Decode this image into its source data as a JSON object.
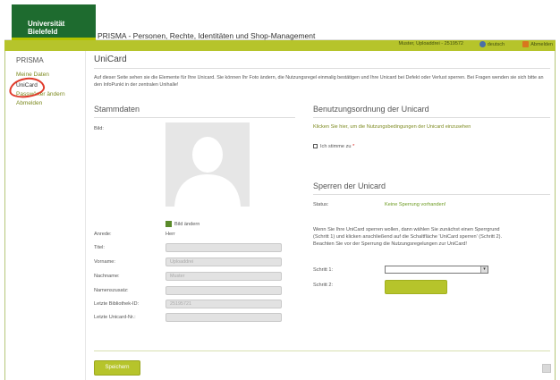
{
  "header": {
    "logo_text": "Universität Bielefeld",
    "app_title": "PRISMA - Personen, Rechte, Identitäten und Shop-Management"
  },
  "userbar": {
    "user": "Muster, Uploaddrei - 2519572",
    "language": "deutsch",
    "logout": "Abmelden"
  },
  "sidebar": {
    "heading": "PRISMA",
    "items": [
      {
        "label": "Meine Daten"
      },
      {
        "label": "UniCard"
      },
      {
        "label": "Passwörter ändern"
      },
      {
        "label": "Abmelden"
      }
    ]
  },
  "main": {
    "title": "UniCard",
    "intro": "Auf dieser Seite sehen sie die Elemente für Ihre Unicard. Sie können Ihr Foto ändern, die Nutzungsregel einmalig bestätigen und Ihre Unicard bei Defekt oder Verlust sperren. Bei Fragen wenden sie sich bitte an den InfoPunkt in der zentralen Unihalle!"
  },
  "stammdaten": {
    "title": "Stammdaten",
    "bild_label": "Bild:",
    "bild_aendern": "Bild ändern",
    "fields": [
      {
        "label": "Anrede:",
        "value": "Herr",
        "type": "text"
      },
      {
        "label": "Titel:",
        "value": "",
        "type": "input"
      },
      {
        "label": "Vorname:",
        "value": "Uploaddrei",
        "type": "input"
      },
      {
        "label": "Nachname:",
        "value": "Muster",
        "type": "input"
      },
      {
        "label": "Namenszusatz:",
        "value": "",
        "type": "input"
      },
      {
        "label": "Letzte Bibliothek-ID:",
        "value": "25195721",
        "type": "input"
      },
      {
        "label": "Letzte Unicard-Nr.:",
        "value": "",
        "type": "input"
      }
    ]
  },
  "benutzung": {
    "title": "Benutzungsordnung der Unicard",
    "link": "Klicken Sie hier, um die Nutzungsbedingungen der Unicard einzusehen",
    "checkbox_label": "Ich stimme zu",
    "required_mark": "*"
  },
  "sperren": {
    "title": "Sperren der Unicard",
    "status_label": "Status:",
    "status_value": "Keine Sperrung vorhanden!",
    "info": "Wenn Sie Ihre UniCard sperren wollen, dann wählen Sie zunächst einen Sperrgrund (Schritt 1) und klicken anschließend auf die Schaltfläche 'UniCard sperren' (Schritt 2). Beachten Sie vor der Sperrung die Nutzungsregelungen zur UniCard!",
    "schritt1": "Schritt 1:",
    "schritt2": "Schritt 2:"
  },
  "actions": {
    "save": "Speichern"
  },
  "colors": {
    "brand_green": "#1e6b2f",
    "accent_olive": "#b6c42b",
    "link": "#7d8a20",
    "ok_status": "#6b9a1f"
  }
}
